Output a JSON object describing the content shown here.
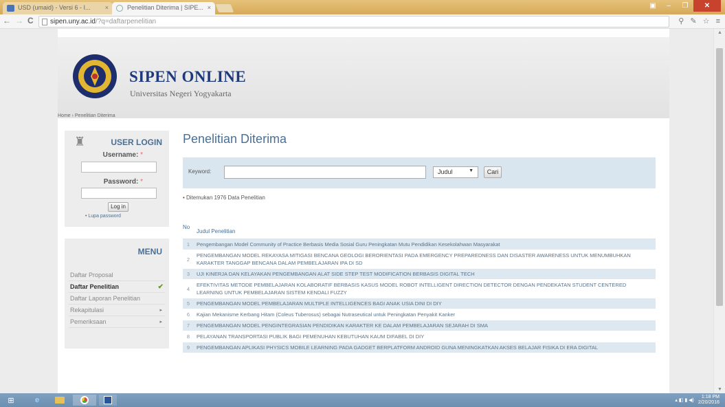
{
  "browser": {
    "tabs": [
      {
        "label": "USD (umaid) - Versi 6 - I...",
        "close": "×"
      },
      {
        "label": "Penelitian Diterima | SIPE...",
        "close": "×"
      }
    ],
    "window_controls": {
      "minimize": "–",
      "maximize": "❐",
      "close": "✕"
    },
    "address": {
      "host": "sipen.uny.ac.id",
      "path": "/?q=daftarpenelitian"
    },
    "nav": {
      "back": "←",
      "forward": "→",
      "reload": "C"
    },
    "toolbar_icons": "⚲ ✎ ☆ ≡"
  },
  "site": {
    "title": "SIPEN ONLINE",
    "subtitle": "Universitas Negeri Yogyakarta",
    "breadcrumb": "Home › Penelitian Diterima"
  },
  "login": {
    "title": "USER LOGIN",
    "username_label": "Username:",
    "password_label": "Password:",
    "required_mark": "*",
    "login_button": "Log in",
    "lost_password": "• Lupa password"
  },
  "menu": {
    "title": "MENU",
    "items": [
      {
        "label": "Daftar Proposal",
        "marker": ""
      },
      {
        "label": "Daftar Penelitian",
        "marker": "✔"
      },
      {
        "label": "Daftar Laporan Penelitian",
        "marker": ""
      },
      {
        "label": "Rekapitulasi",
        "marker": "▸"
      },
      {
        "label": "Pemeriksaan",
        "marker": "▸"
      }
    ]
  },
  "main": {
    "title": "Penelitian Diterima",
    "search": {
      "keyword_label": "Keyword:",
      "keyword_value": "",
      "select_value": "Judul",
      "search_button": "Cari"
    },
    "found_text": "• Ditemukan 1976 Data Penelitian",
    "table": {
      "col_no": "No",
      "col_title": "Judul Penelitian",
      "rows": [
        {
          "no": "1",
          "title": "Pengembangan Model Community of Practice Berbasis Media Sosial Guru Peningkatan Mutu Pendidikan Kesekolahwan Masyarakat"
        },
        {
          "no": "2",
          "title": "PENGEMBANGAN MODEL REKAYASA MITIGASI BENCANA GEOLOGI BERORIENTASI PADA EMERGENCY PREPAREDNESS DAN DISASTER AWARENESS UNTUK MENUMBUHKAN KARAKTER TANGGAP BENCANA DALAM PEMBELAJARAN IPA DI SD"
        },
        {
          "no": "3",
          "title": "UJI KINERJA DAN KELAYAKAN PENGEMBANGAN ALAT SIDE STEP TEST MODIFICATION BERBASIS DIGITAL TECH"
        },
        {
          "no": "4",
          "title": "EFEKTIVITAS METODE PEMBELAJARAN KOLABORATIF BERBASIS KASUS MODEL ROBOT INTELLIGENT DIRECTION DETECTOR DENGAN PENDEKATAN STUDENT CENTERED LEARNING UNTUK PEMBELAJARAN SISTEM KENDALI FUZZY"
        },
        {
          "no": "5",
          "title": "PENGEMBANGAN MODEL PEMBELAJARAN MULTIPLE INTELLIGENCES BAGI ANAK USIA DINI DI DIY"
        },
        {
          "no": "6",
          "title": "Kajian Mekanisme Kerbang Hitam (Coleus Tuberosus) sebagai Nutraseutical untuk Peningkatan Penyakit Kanker"
        },
        {
          "no": "7",
          "title": "PENGEMBANGAN MODEL PENGINTEGRASIAN PENDIDIKAN KARAKTER KE DALAM PEMBELAJARAN SEJARAH DI SMA"
        },
        {
          "no": "8",
          "title": "PELAYANAN TRANSPORTASI PUBLIK BAGI PEMENUHAN KEBUTUHAN KAUM DIFABEL DI DIY"
        },
        {
          "no": "9",
          "title": "PENGEMBANGAN APLIKASI PHYSICS MOBILE LEARNING PADA GADGET BERPLATFORM ANDROID GUNA MENINGKATKAN AKSES BELAJAR FISIKA DI ERA DIGITAL"
        }
      ]
    }
  },
  "taskbar": {
    "tray_time": "1:18 PM",
    "tray_date": "2/20/2016"
  }
}
